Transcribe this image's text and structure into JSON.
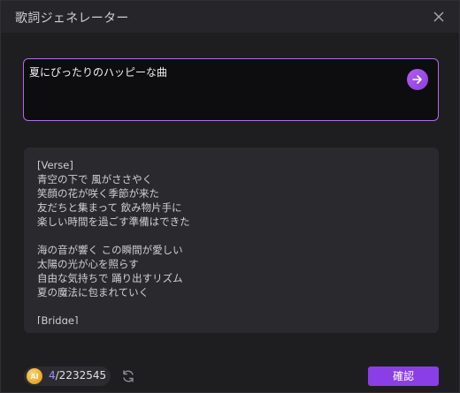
{
  "window": {
    "title": "歌詞ジェネレーター",
    "close_icon": "close-icon"
  },
  "prompt": {
    "value": "夏にぴったりのハッピーな曲",
    "send_icon": "arrow-right-icon"
  },
  "lyrics": {
    "lines": [
      "[Verse]",
      "青空の下で 風がささやく",
      "笑顔の花が咲く季節が来た",
      "友だちと集まって 飲み物片手に",
      "楽しい時間を過ごす準備はできた",
      "",
      "海の音が響く この瞬間が愛しい",
      "太陽の光が心を照らす",
      "自由な気持ちで 踊り出すリズム",
      "夏の魔法に包まれていく",
      "",
      "[Bridge]"
    ]
  },
  "footer": {
    "coin_label": "AI",
    "credits_used": "4",
    "credits_total": "/2232545",
    "refresh_icon": "refresh-icon",
    "confirm_label": "確認"
  },
  "colors": {
    "accent": "#8a3fe6",
    "prompt_border": "#b06ae8",
    "credit_highlight": "#a58cff"
  }
}
